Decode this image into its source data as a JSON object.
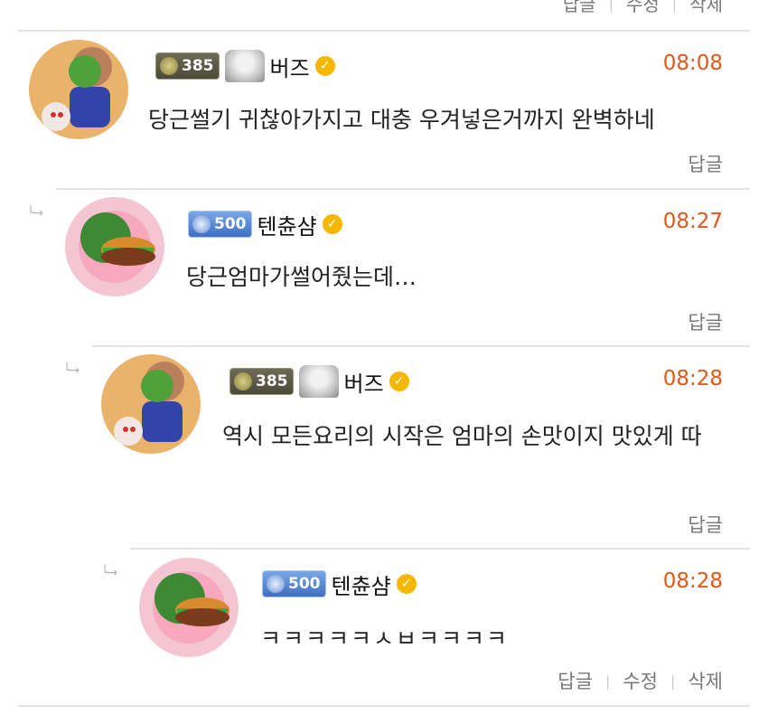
{
  "top_actions": {
    "reply": "답글",
    "edit": "수정",
    "delete": "삭제"
  },
  "comments": [
    {
      "level": "385",
      "nickname": "버즈",
      "time": "08:08",
      "text": "당근썰기 귀찮아가지고 대충 우겨넣은거까지 완벽하네",
      "reply_label": "답글"
    },
    {
      "level": "500",
      "nickname": "텐츈샴",
      "time": "08:27",
      "text": "당근엄마가썰어줬는데…",
      "reply_label": "답글"
    },
    {
      "level": "385",
      "nickname": "버즈",
      "time": "08:28",
      "text": "역시 모든요리의 시작은 엄마의 손맛이지 맛있게 따",
      "reply_label": "답글"
    },
    {
      "level": "500",
      "nickname": "텐츈샴",
      "time": "08:28",
      "text": "ㅋㅋㅋㅋㅋㅅㅂㅋㅋㅋㅋ",
      "reply_label": "답글",
      "edit_label": "수정",
      "delete_label": "삭제"
    }
  ],
  "colors": {
    "time": "#e0581a",
    "verified": "#f5b700",
    "divider": "#e3e3e3"
  },
  "icons": {
    "reply_indent": "reply-arrow-icon",
    "verified": "verified-check-icon"
  }
}
